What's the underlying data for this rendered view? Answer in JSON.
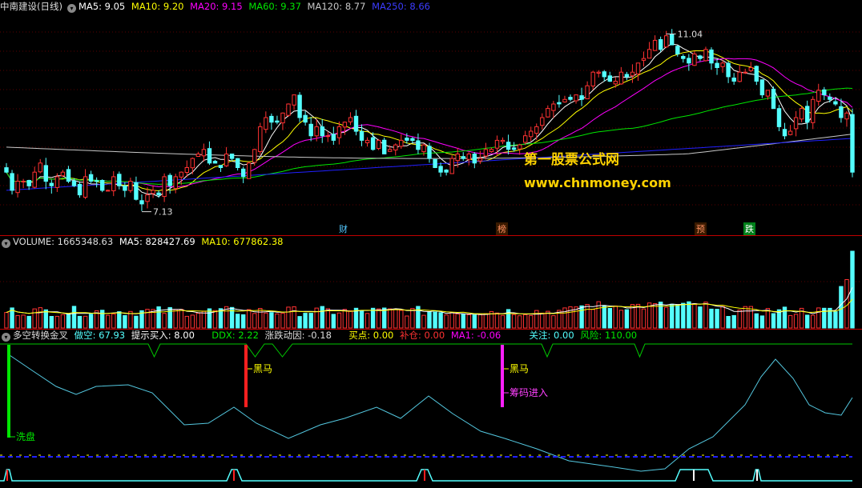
{
  "price_header": {
    "title": "中南建设(日线)",
    "ma5": "MA5: 9.05",
    "ma10": "MA10: 9.20",
    "ma20": "MA20: 9.15",
    "ma60": "MA60: 9.37",
    "ma120": "MA120: 8.77",
    "ma250": "MA250: 8.66"
  },
  "volume_header": {
    "volume": "VOLUME: 1665348.63",
    "ma5": "MA5: 828427.69",
    "ma10": "MA10: 677862.38"
  },
  "indicator_header": {
    "name": "多空转换金叉",
    "zuokong": "做空: 67.93",
    "tishi": "提示买入: 8.00",
    "ddx": "DDX: 2.22",
    "zhangdie": "涨跌动因: -0.18",
    "maidian": "买点: 0.00",
    "bucang": "补仓: 0.00",
    "ma1": "MA1: -0.06",
    "guanzhu": "关注: 0.00",
    "fengxian": "风险: 110.00"
  },
  "price_labels": {
    "high": "11.04",
    "low": "7.13"
  },
  "events": {
    "cai": "财",
    "bang": "榜",
    "yu": "预",
    "die": "跌"
  },
  "signals": {
    "xipan": "洗盘",
    "heima1": "黑马",
    "heima2": "黑马",
    "chouma": "筹码进入"
  },
  "watermark": {
    "line1": "第一股票公式网",
    "line2": "www.chnmoney.com"
  },
  "colors": {
    "up": "#ff3232",
    "down": "#54ffff",
    "ma5": "#ffffff",
    "ma10": "#ffff00",
    "ma20": "#ff00ff",
    "ma60": "#00e600",
    "ma120": "#c8c8c8",
    "ma250": "#2020ff"
  },
  "chart_data": {
    "type": "candlestick",
    "price_range": [
      7.0,
      11.4
    ],
    "price_high": 11.04,
    "price_low": 7.13,
    "closes": [
      8.0,
      7.6,
      7.8,
      7.8,
      7.7,
      8.0,
      8.2,
      7.8,
      7.7,
      7.9,
      8.0,
      7.8,
      7.7,
      7.5,
      7.9,
      7.8,
      7.8,
      7.6,
      7.6,
      7.9,
      7.7,
      7.6,
      7.8,
      7.4,
      7.3,
      7.5,
      7.6,
      7.5,
      7.9,
      7.7,
      7.9,
      8.0,
      8.1,
      8.3,
      8.4,
      8.5,
      8.2,
      8.2,
      8.1,
      8.4,
      8.3,
      8.1,
      7.9,
      8.2,
      8.5,
      9.0,
      9.2,
      9.1,
      9.1,
      9.3,
      9.5,
      9.7,
      9.2,
      9.1,
      8.8,
      9.0,
      8.8,
      8.8,
      8.7,
      9.0,
      9.1,
      9.2,
      8.9,
      8.7,
      8.7,
      8.5,
      8.7,
      8.4,
      8.5,
      8.6,
      8.7,
      8.7,
      8.7,
      8.5,
      8.6,
      8.3,
      8.1,
      8.0,
      8.0,
      8.3,
      8.4,
      8.3,
      8.4,
      8.2,
      8.3,
      8.5,
      8.5,
      8.7,
      8.7,
      8.5,
      8.5,
      8.6,
      8.8,
      8.9,
      9.0,
      9.2,
      9.4,
      9.5,
      9.5,
      9.6,
      9.6,
      9.7,
      9.6,
      9.9,
      10.2,
      10.2,
      10.1,
      10.0,
      10.0,
      10.2,
      10.1,
      10.2,
      10.4,
      10.5,
      10.7,
      10.9,
      10.7,
      11.0,
      10.8,
      10.6,
      10.5,
      10.4,
      10.6,
      10.5,
      10.7,
      10.4,
      10.3,
      10.4,
      10.1,
      10.0,
      10.2,
      10.2,
      10.3,
      10.0,
      9.7,
      9.8,
      9.4,
      9.0,
      8.8,
      8.9,
      9.2,
      9.4,
      9.1,
      9.6,
      9.8,
      9.7,
      9.6,
      9.5,
      9.2,
      9.3,
      8.0
    ],
    "volume_range": [
      0,
      1700000
    ],
    "indicator_lines": [
      "做空",
      "提示买入",
      "DDX",
      "涨跌动因",
      "买点",
      "补仓",
      "MA1",
      "关注",
      "风险"
    ]
  }
}
